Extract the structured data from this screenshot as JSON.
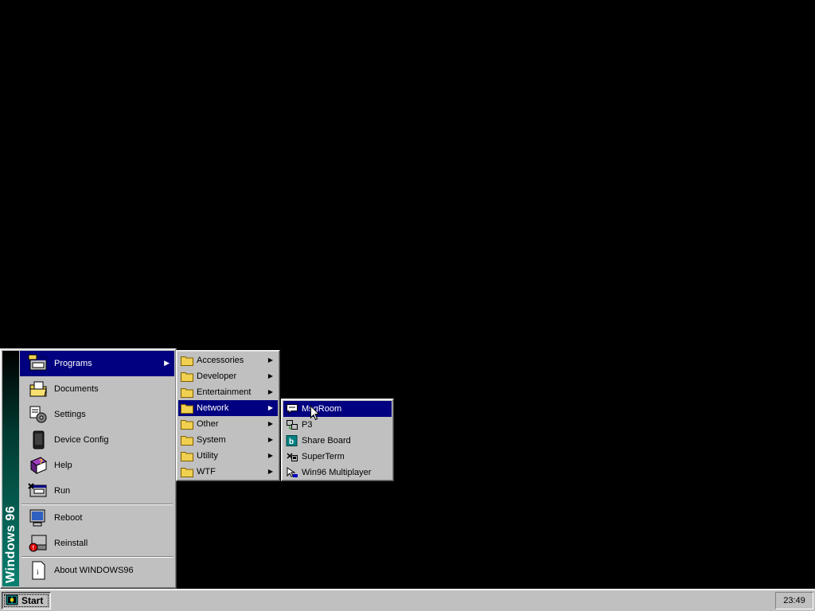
{
  "desktop": {
    "background": "#000000"
  },
  "start_menu": {
    "banner": "Windows 96",
    "banner_colors": [
      "#000000",
      "#0a8070"
    ],
    "items": [
      {
        "label": "Programs",
        "icon": "programs-icon",
        "has_submenu": true,
        "selected": true
      },
      {
        "label": "Documents",
        "icon": "documents-folder-icon"
      },
      {
        "label": "Settings",
        "icon": "settings-icon"
      },
      {
        "label": "Device Config",
        "icon": "device-icon"
      },
      {
        "label": "Help",
        "icon": "help-book-icon"
      },
      {
        "label": "Run",
        "icon": "run-icon"
      },
      {
        "label": "Reboot",
        "icon": "reboot-icon"
      },
      {
        "label": "Reinstall",
        "icon": "reinstall-icon"
      },
      {
        "label": "About WINDOWS96",
        "icon": "about-icon"
      }
    ]
  },
  "programs_menu": {
    "items": [
      {
        "label": "Accessories",
        "icon": "folder-icon",
        "has_submenu": true
      },
      {
        "label": "Developer",
        "icon": "folder-icon",
        "has_submenu": true
      },
      {
        "label": "Entertainment",
        "icon": "folder-icon",
        "has_submenu": true
      },
      {
        "label": "Network",
        "icon": "folder-icon",
        "has_submenu": true,
        "selected": true
      },
      {
        "label": "Other",
        "icon": "folder-icon",
        "has_submenu": true
      },
      {
        "label": "System",
        "icon": "folder-icon",
        "has_submenu": true
      },
      {
        "label": "Utility",
        "icon": "folder-icon",
        "has_submenu": true
      },
      {
        "label": "WTF",
        "icon": "folder-icon",
        "has_submenu": true
      }
    ]
  },
  "network_menu": {
    "items": [
      {
        "label": "MsgRoom",
        "icon": "msgroom-icon",
        "selected": true
      },
      {
        "label": "P3",
        "icon": "p3-icon"
      },
      {
        "label": "Share Board",
        "icon": "share-board-icon"
      },
      {
        "label": "SuperTerm",
        "icon": "superterm-icon"
      },
      {
        "label": "Win96 Multiplayer",
        "icon": "multiplayer-icon"
      }
    ]
  },
  "taskbar": {
    "start_label": "Start",
    "clock": "23:49"
  },
  "colors": {
    "menu_face": "#c0c0c0",
    "selection": "#000080"
  }
}
